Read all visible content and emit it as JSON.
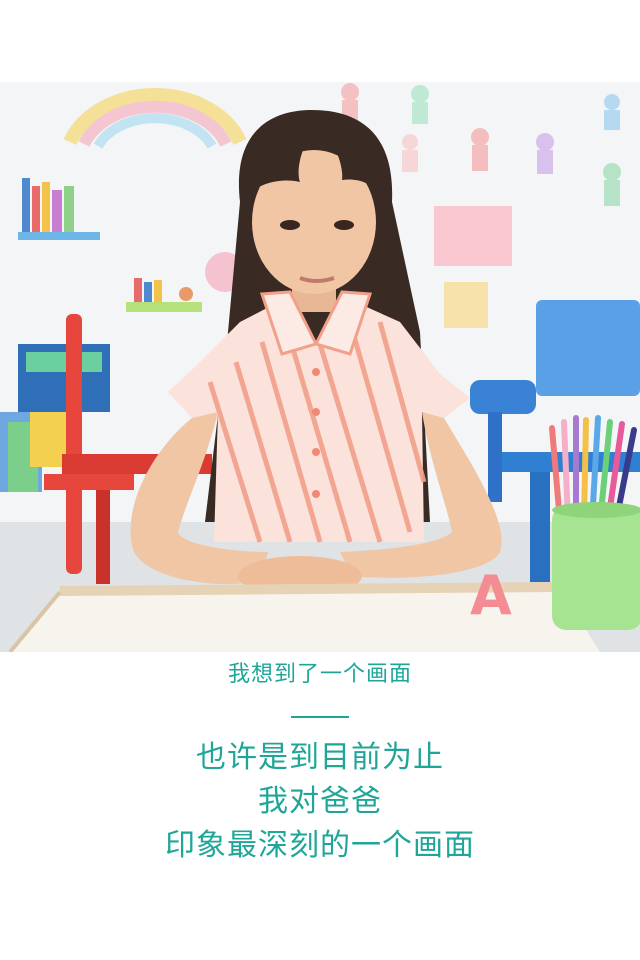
{
  "photo": {
    "alt": "classroom-portrait",
    "subject": "girl-seated-at-desk",
    "desk_letter": "A",
    "colors": {
      "wall": "#f3f5f6",
      "shirt": "#f6b7a5",
      "chair_red": "#e6463c",
      "chair_blue": "#3a82d6",
      "cup_green": "#9ee08a",
      "desk": "#f7f4ee"
    }
  },
  "caption": {
    "subtitle": "我想到了一个画面",
    "lines": [
      "也许是到目前为止",
      "我对爸爸",
      "印象最深刻的一个画面"
    ],
    "accent_color": "#1fa698"
  }
}
